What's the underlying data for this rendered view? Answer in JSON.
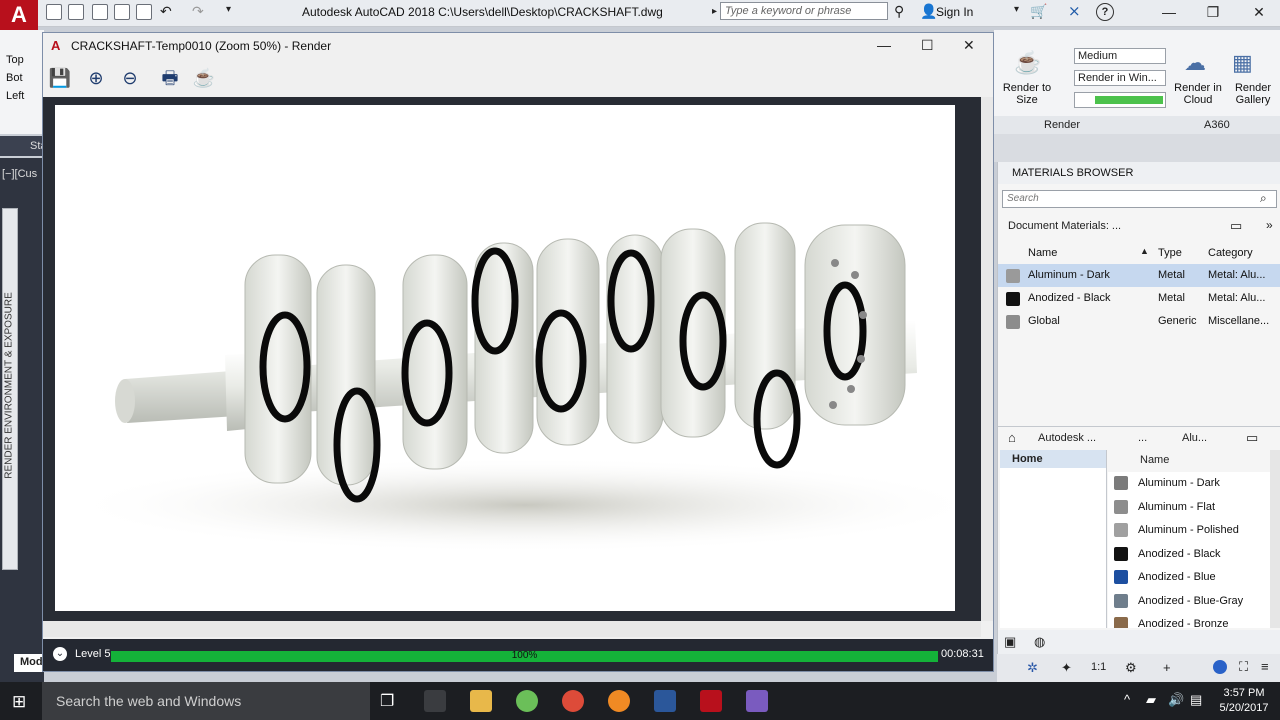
{
  "app": {
    "logo": "A",
    "title": "Autodesk AutoCAD 2018    C:\\Users\\dell\\Desktop\\CRACKSHAFT.dwg",
    "search_placeholder": "Type a keyword or phrase",
    "sign_in": "Sign In",
    "help": "?"
  },
  "left_ribbon": {
    "view_items": [
      "Top",
      "Bot",
      "Left"
    ],
    "doc_tab": "Sta",
    "viewport_label": "[−][Cus",
    "palette_label": "RENDER ENVIRONMENT & EXPOSURE",
    "model_tab": "Mod"
  },
  "render_window": {
    "title": "CRACKSHAFT-Temp0010 (Zoom 50%) - Render",
    "progress_level": "Level 5",
    "progress_percent": "100%",
    "progress_value": 1.0,
    "elapsed_time": "00:08:31"
  },
  "ribbon_right": {
    "render_to_size": "Render to Size",
    "render_quality": "Medium",
    "render_target": "Render in Win...",
    "render_in_cloud": "Render in Cloud",
    "render_gallery": "Render Gallery",
    "panel_render": "Render",
    "panel_a360": "A360"
  },
  "materials_browser": {
    "title": "MATERIALS BROWSER",
    "search_placeholder": "Search",
    "document_materials": "Document Materials: ...",
    "columns": {
      "name": "Name",
      "type": "Type",
      "category": "Category"
    },
    "document_rows": [
      {
        "name": "Aluminum - Dark",
        "type": "Metal",
        "category": "Metal: Alu...",
        "swatch": "#9a9a9a"
      },
      {
        "name": "Anodized - Black",
        "type": "Metal",
        "category": "Metal: Alu...",
        "swatch": "#111111"
      },
      {
        "name": "Global",
        "type": "Generic",
        "category": "Miscellane...",
        "swatch": "#8c8c8c"
      }
    ],
    "library_breadcrumb": [
      "Autodesk ...",
      "...",
      "Alu..."
    ],
    "tree_home": "Home",
    "library_column": "Name",
    "library_rows": [
      {
        "name": "Aluminum - Dark",
        "swatch": "#7b7b7b"
      },
      {
        "name": "Aluminum - Flat",
        "swatch": "#8d8d8d"
      },
      {
        "name": "Aluminum - Polished",
        "swatch": "#a0a0a0"
      },
      {
        "name": "Anodized - Black",
        "swatch": "#121212"
      },
      {
        "name": "Anodized - Blue",
        "swatch": "#1d4fa0"
      },
      {
        "name": "Anodized - Blue-Gray",
        "swatch": "#6f7e8c"
      },
      {
        "name": "Anodized - Bronze",
        "swatch": "#8a6a4a"
      }
    ]
  },
  "status_bar": {
    "scale": "1:1"
  },
  "taskbar": {
    "search_placeholder": "Search the web and Windows",
    "time": "3:57 PM",
    "date": "5/20/2017"
  },
  "colors": {
    "autocad_red": "#b8101c",
    "progress_green": "#14b239",
    "selected_row": "#c6d8ef"
  }
}
